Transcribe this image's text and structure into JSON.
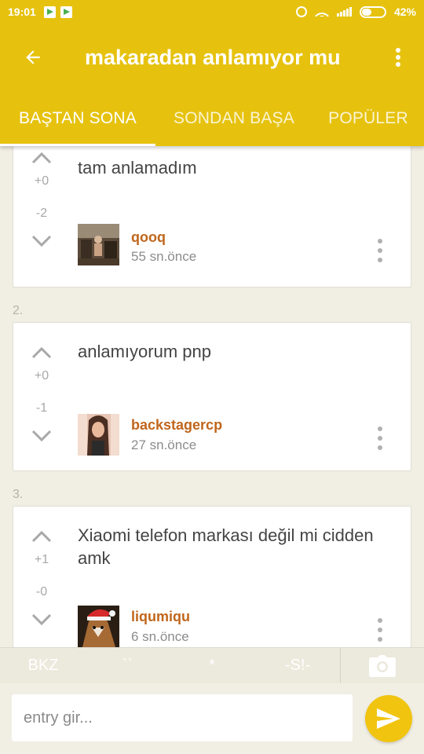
{
  "status_bar": {
    "time": "19:01",
    "battery": "42%",
    "battery_level": 0.42,
    "notification_icons": [
      "play-store-icon",
      "play-store-icon"
    ]
  },
  "app_bar": {
    "title": "makaradan anlamıyor mu"
  },
  "tabs": [
    {
      "label": "BAŞTAN SONA",
      "active": true
    },
    {
      "label": "SONDAN BAŞA",
      "active": false
    },
    {
      "label": "POPÜLER",
      "active": false
    }
  ],
  "entries": [
    {
      "number": "",
      "text": "tam anlamadım",
      "upvotes": "+0",
      "downvotes": "-2",
      "author": "qooq",
      "time": "55 sn.önce"
    },
    {
      "number": "2.",
      "text": "anlamıyorum pnp",
      "upvotes": "+0",
      "downvotes": "-1",
      "author": "backstagercp",
      "time": "27 sn.önce"
    },
    {
      "number": "3.",
      "text": "Xiaomi telefon markası değil mi cidden amk",
      "upvotes": "+1",
      "downvotes": "-0",
      "author": "liqumiqu",
      "time": "6 sn.önce"
    }
  ],
  "format_bar": {
    "bkz": "BKZ",
    "quote": "``",
    "star": "*",
    "spoiler": "-S!-"
  },
  "compose": {
    "placeholder": "entry gir..."
  },
  "colors": {
    "accent": "#e6c20f",
    "author": "#c0661c",
    "background": "#f1eee4",
    "send": "#f1c40f"
  }
}
